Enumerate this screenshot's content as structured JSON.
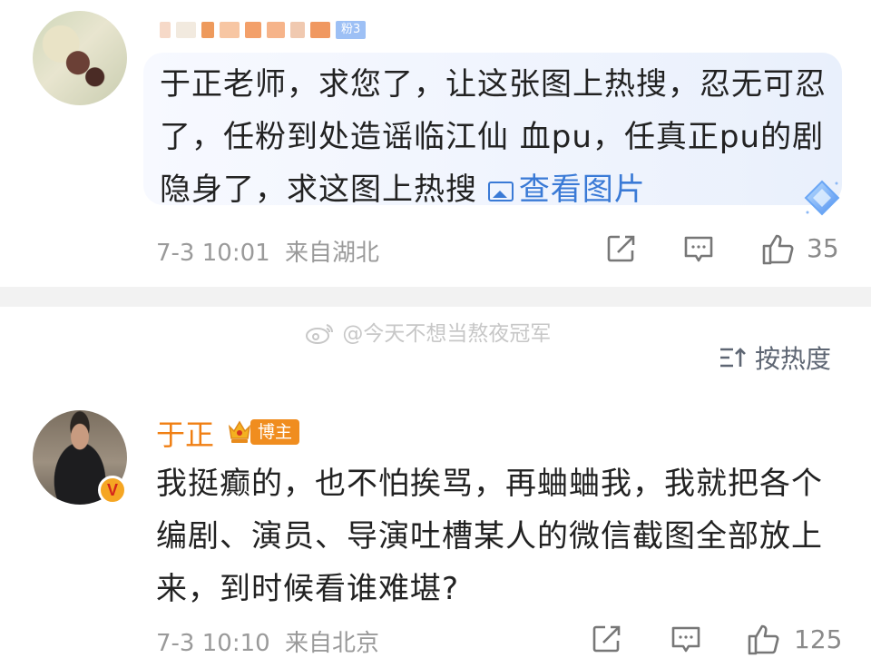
{
  "comment1": {
    "author_badge": "粉3",
    "text_main": "于正老师，求您了，让这张图上热搜，忍无可忍了，任粉到处造谣临江仙 血pu，任真正pu的剧隐身了，求这图上热搜",
    "image_link_label": "查看图片",
    "time": "7-3 10:01",
    "location": "来自湖北",
    "like_count": "35"
  },
  "watermark": "@今天不想当熬夜冠军",
  "sort": {
    "label": "按热度"
  },
  "comment2": {
    "author_name": "于正",
    "role_tag": "博主",
    "verify_badge": "V",
    "text": "我挺癫的，也不怕挨骂，再蛐蛐我，我就把各个编剧、演员、导演吐槽某人的微信截图全部放上来，到时候看谁难堪?",
    "time": "7-3 10:10",
    "location": "来自北京",
    "like_count": "125"
  },
  "icons": [
    "share-icon",
    "comment-icon",
    "like-icon",
    "image-icon",
    "sort-icon",
    "crown-icon",
    "weibo-logo-icon",
    "diamond-badge-icon"
  ],
  "colors": {
    "link_blue": "#3a7ad6",
    "name_orange": "#f07f13",
    "meta_gray": "#9a9a9a",
    "bubble_bg": "#eef3fd"
  }
}
